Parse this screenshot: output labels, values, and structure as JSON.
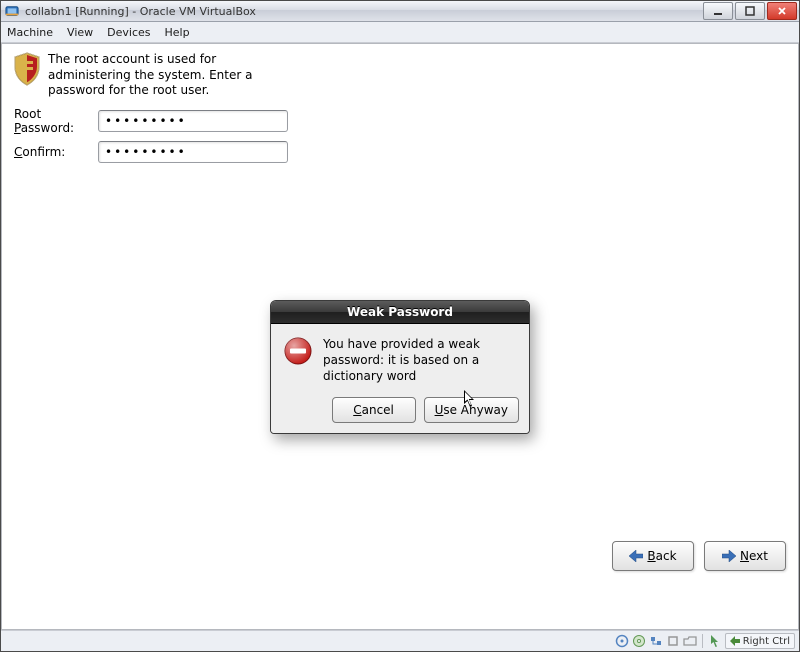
{
  "window": {
    "title": "collabn1 [Running] - Oracle VM VirtualBox"
  },
  "menu": {
    "machine": "Machine",
    "view": "View",
    "devices": "Devices",
    "help": "Help"
  },
  "installer": {
    "header_text": "The root account is used for administering the system.  Enter a password for the root user.",
    "root_password_label_pre": "Root ",
    "root_password_label_u": "P",
    "root_password_label_post": "assword:",
    "confirm_label_u": "C",
    "confirm_label_post": "onfirm:",
    "root_password_value": "•••••••••",
    "confirm_value": "•••••••••"
  },
  "dialog": {
    "title": "Weak Password",
    "message": "You have provided a weak password: it is based on a dictionary word",
    "cancel_u": "C",
    "cancel_post": "ancel",
    "use_u": "U",
    "use_post": "se Anyway"
  },
  "wizard": {
    "back_u": "B",
    "back_post": "ack",
    "next_u": "N",
    "next_post": "ext"
  },
  "statusbar": {
    "host_key": "Right Ctrl"
  }
}
